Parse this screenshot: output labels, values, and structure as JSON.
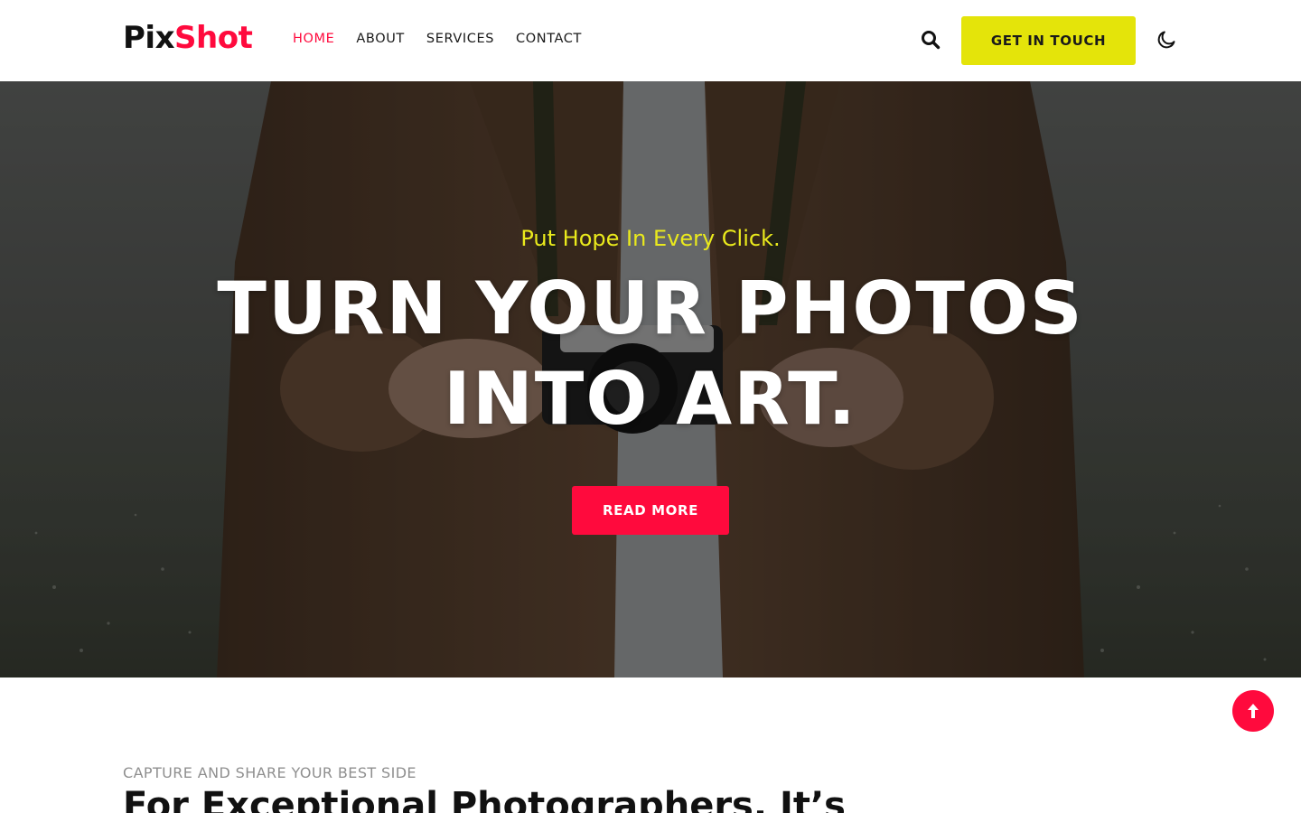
{
  "brand": {
    "logo_part1": "Pix",
    "logo_part2": "Shot",
    "color_primary": "#ff0a3d",
    "color_accent": "#e4e40a"
  },
  "nav": {
    "items": [
      {
        "label": "HOME",
        "active": true
      },
      {
        "label": "ABOUT",
        "active": false
      },
      {
        "label": "SERVICES",
        "active": false
      },
      {
        "label": "CONTACT",
        "active": false
      }
    ]
  },
  "header": {
    "search_icon": "search-icon",
    "cta_label": "GET IN TOUCH",
    "theme_icon": "moon-icon"
  },
  "hero": {
    "tagline": "Put Hope In Every Click.",
    "title_line1": "TURN YOUR PHOTOS",
    "title_line2": "INTO ART.",
    "button_label": "READ MORE"
  },
  "scroll_top_icon": "arrow-up-icon",
  "intro": {
    "eyebrow": "CAPTURE AND SHARE YOUR BEST SIDE",
    "title": "For Exceptional Photographers, It’s"
  }
}
